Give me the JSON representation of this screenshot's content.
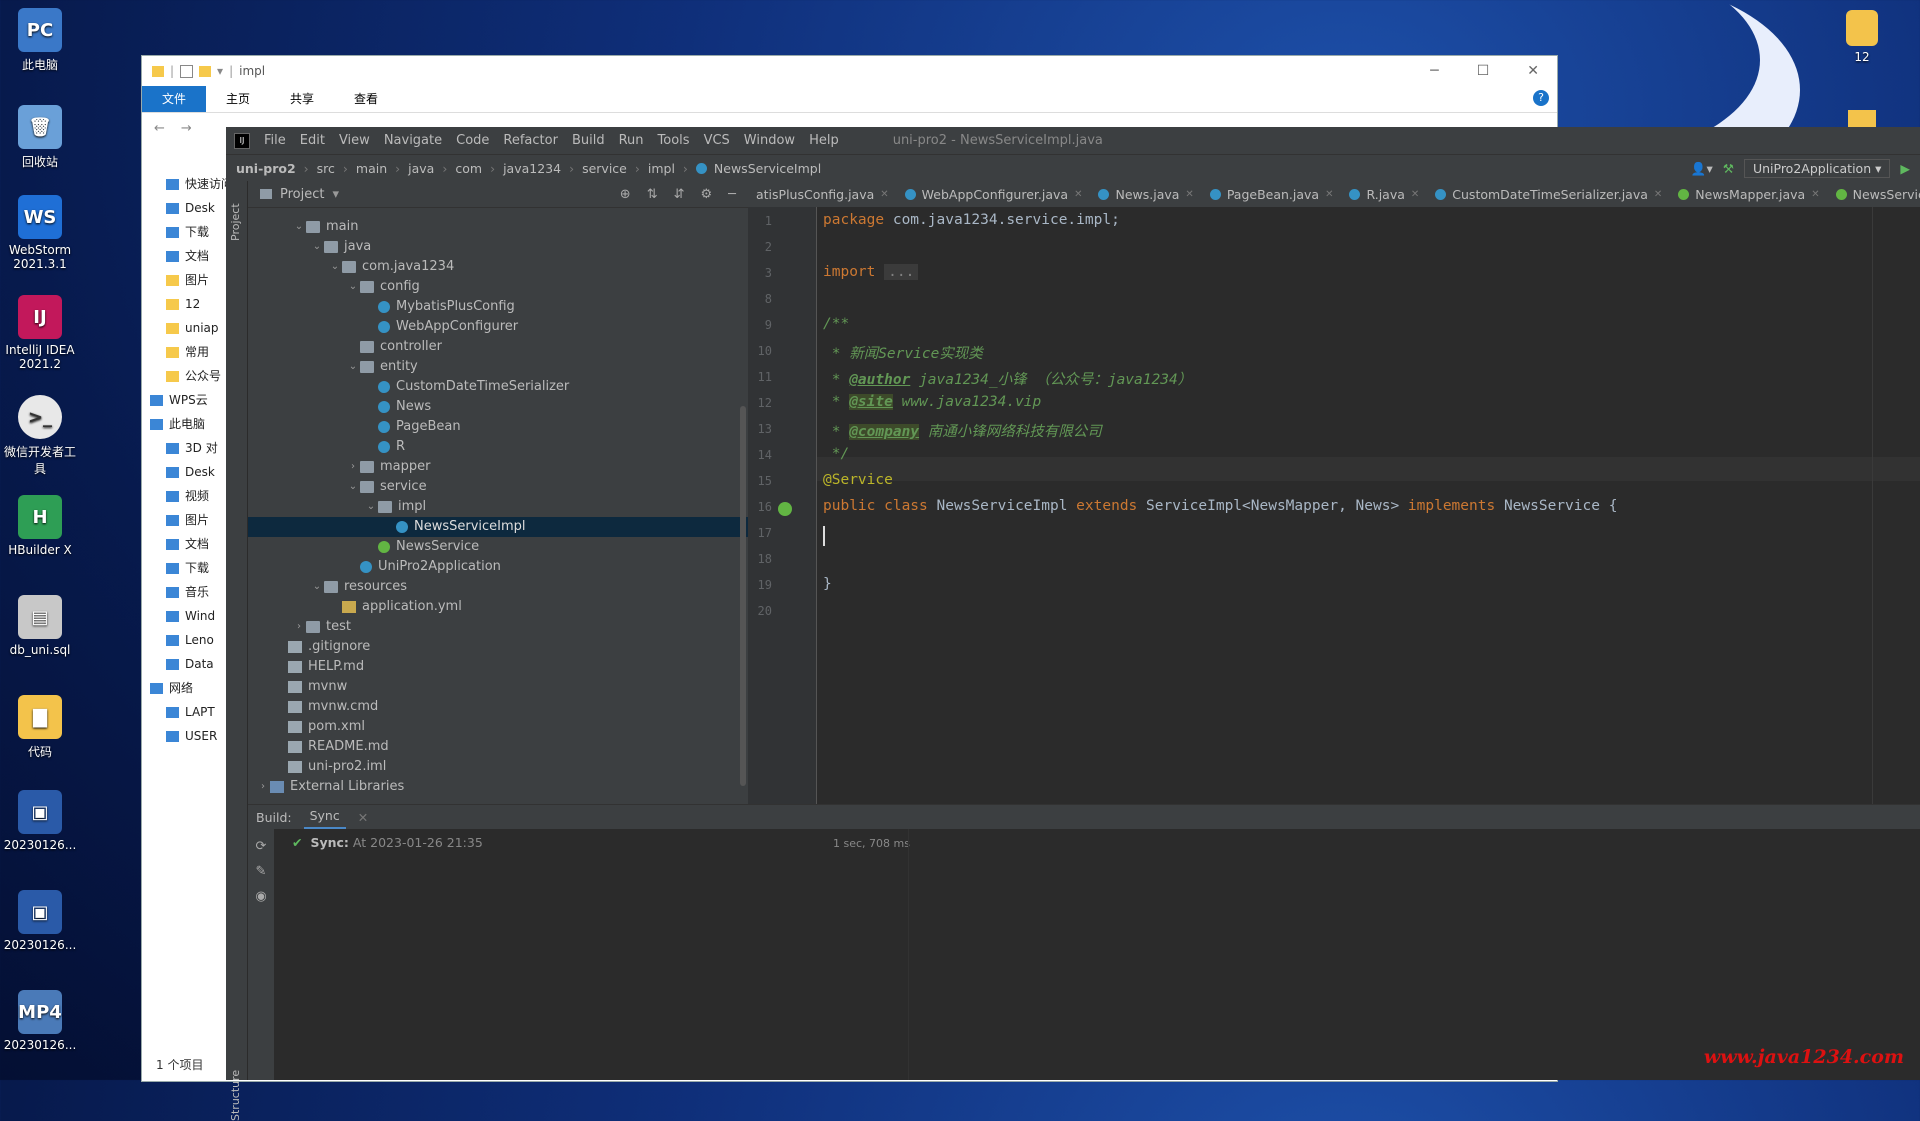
{
  "desktop": {
    "icons": [
      {
        "label": "此电脑",
        "ic": "PC"
      },
      {
        "label": "回收站",
        "ic": "🗑"
      },
      {
        "label": "WebStorm 2021.3.1",
        "ic": "WS"
      },
      {
        "label": "IntelliJ IDEA 2021.2",
        "ic": "IJ"
      },
      {
        "label": "微信开发者工具",
        "ic": ">_"
      },
      {
        "label": "HBuilder X",
        "ic": "H"
      },
      {
        "label": "db_uni.sql",
        "ic": "▤"
      },
      {
        "label": "代码",
        "ic": "▇"
      },
      {
        "label": "20230126...",
        "ic": "▣"
      },
      {
        "label": "20230126...",
        "ic": "▣"
      },
      {
        "label": "20230126...",
        "ic": "MP4"
      }
    ],
    "right_icon_label": "12",
    "watermark": "www.java1234.com"
  },
  "explorer": {
    "title": "impl",
    "ribbon": [
      "文件",
      "主页",
      "共享",
      "查看"
    ],
    "sidebar": [
      "快速访问",
      "Desk",
      "下载",
      "文档",
      "图片",
      "12",
      "uniap",
      "常用",
      "公众号",
      "WPS云",
      "此电脑",
      "3D 对",
      "Desk",
      "视频",
      "图片",
      "文档",
      "下载",
      "音乐",
      "Wind",
      "Leno",
      "Data",
      "网络",
      "LAPT",
      "USER"
    ],
    "status": "1 个项目"
  },
  "ide": {
    "window_title": "uni-pro2 - NewsServiceImpl.java",
    "menu": [
      "File",
      "Edit",
      "View",
      "Navigate",
      "Code",
      "Refactor",
      "Build",
      "Run",
      "Tools",
      "VCS",
      "Window",
      "Help"
    ],
    "breadcrumb": [
      "uni-pro2",
      "src",
      "main",
      "java",
      "com",
      "java1234",
      "service",
      "impl",
      "NewsServiceImpl"
    ],
    "run_config": "UniPro2Application",
    "project_label": "Project",
    "tree": [
      {
        "indent": 2,
        "arrow": "⌄",
        "icon": "folder",
        "label": "main"
      },
      {
        "indent": 3,
        "arrow": "⌄",
        "icon": "folder",
        "label": "java"
      },
      {
        "indent": 4,
        "arrow": "⌄",
        "icon": "folder",
        "label": "com.java1234"
      },
      {
        "indent": 5,
        "arrow": "⌄",
        "icon": "folder",
        "label": "config"
      },
      {
        "indent": 6,
        "arrow": "",
        "icon": "cls",
        "label": "MybatisPlusConfig"
      },
      {
        "indent": 6,
        "arrow": "",
        "icon": "cls",
        "label": "WebAppConfigurer"
      },
      {
        "indent": 5,
        "arrow": "",
        "icon": "folder",
        "label": "controller"
      },
      {
        "indent": 5,
        "arrow": "⌄",
        "icon": "folder",
        "label": "entity"
      },
      {
        "indent": 6,
        "arrow": "",
        "icon": "cls",
        "label": "CustomDateTimeSerializer"
      },
      {
        "indent": 6,
        "arrow": "",
        "icon": "cls",
        "label": "News"
      },
      {
        "indent": 6,
        "arrow": "",
        "icon": "cls",
        "label": "PageBean"
      },
      {
        "indent": 6,
        "arrow": "",
        "icon": "cls",
        "label": "R"
      },
      {
        "indent": 5,
        "arrow": "›",
        "icon": "folder",
        "label": "mapper"
      },
      {
        "indent": 5,
        "arrow": "⌄",
        "icon": "folder",
        "label": "service"
      },
      {
        "indent": 6,
        "arrow": "⌄",
        "icon": "folder",
        "label": "impl"
      },
      {
        "indent": 7,
        "arrow": "",
        "icon": "cls",
        "label": "NewsServiceImpl",
        "selected": true
      },
      {
        "indent": 6,
        "arrow": "",
        "icon": "intf",
        "label": "NewsService"
      },
      {
        "indent": 5,
        "arrow": "",
        "icon": "cls",
        "label": "UniPro2Application"
      },
      {
        "indent": 3,
        "arrow": "⌄",
        "icon": "folder",
        "label": "resources"
      },
      {
        "indent": 4,
        "arrow": "",
        "icon": "yml",
        "label": "application.yml"
      },
      {
        "indent": 2,
        "arrow": "›",
        "icon": "folder",
        "label": "test"
      },
      {
        "indent": 1,
        "arrow": "",
        "icon": "file",
        "label": ".gitignore"
      },
      {
        "indent": 1,
        "arrow": "",
        "icon": "file",
        "label": "HELP.md"
      },
      {
        "indent": 1,
        "arrow": "",
        "icon": "file",
        "label": "mvnw"
      },
      {
        "indent": 1,
        "arrow": "",
        "icon": "file",
        "label": "mvnw.cmd"
      },
      {
        "indent": 1,
        "arrow": "",
        "icon": "file",
        "label": "pom.xml"
      },
      {
        "indent": 1,
        "arrow": "",
        "icon": "file",
        "label": "README.md"
      },
      {
        "indent": 1,
        "arrow": "",
        "icon": "file",
        "label": "uni-pro2.iml"
      },
      {
        "indent": 0,
        "arrow": "›",
        "icon": "lib",
        "label": "External Libraries"
      }
    ],
    "tabs": [
      {
        "label": "atisPlusConfig.java",
        "kind": "c"
      },
      {
        "label": "WebAppConfigurer.java",
        "kind": "c"
      },
      {
        "label": "News.java",
        "kind": "c"
      },
      {
        "label": "PageBean.java",
        "kind": "c"
      },
      {
        "label": "R.java",
        "kind": "c"
      },
      {
        "label": "CustomDateTimeSerializer.java",
        "kind": "c"
      },
      {
        "label": "NewsMapper.java",
        "kind": "i"
      },
      {
        "label": "NewsService.java",
        "kind": "i"
      }
    ],
    "line_numbers": [
      "1",
      "2",
      "3",
      "8",
      "9",
      "10",
      "11",
      "12",
      "13",
      "14",
      "15",
      "16",
      "17",
      "18",
      "19",
      "20"
    ],
    "code": {
      "l1_kw": "package",
      "l1_rest": " com.java1234.service.impl;",
      "l3_kw": "import",
      "l3_fold": "...",
      "l9": "/**",
      "l10": " * 新闻Service实现类",
      "l11_a": " * ",
      "l11_tag": "@author",
      "l11_b": " java1234_小锋 （公众号：java1234）",
      "l12_a": " * ",
      "l12_tag": "@site",
      "l12_b": " www.java1234.vip",
      "l13_a": " * ",
      "l13_tag": "@company",
      "l13_b": " 南通小锋网络科技有限公司",
      "l14": " */",
      "l15": "@Service",
      "l16_kw1": "public class",
      "l16_name": " NewsServiceImpl ",
      "l16_kw2": "extends",
      "l16_mid": " ServiceImpl<NewsMapper, News> ",
      "l16_kw3": "implements",
      "l16_end": " NewsService {",
      "l19": "}"
    },
    "build": {
      "label": "Build:",
      "tab": "Sync",
      "sync_label": "Sync:",
      "sync_time": "At 2023-01-26 21:35",
      "duration": "1 sec, 708 ms"
    },
    "structure_label": "Structure"
  }
}
